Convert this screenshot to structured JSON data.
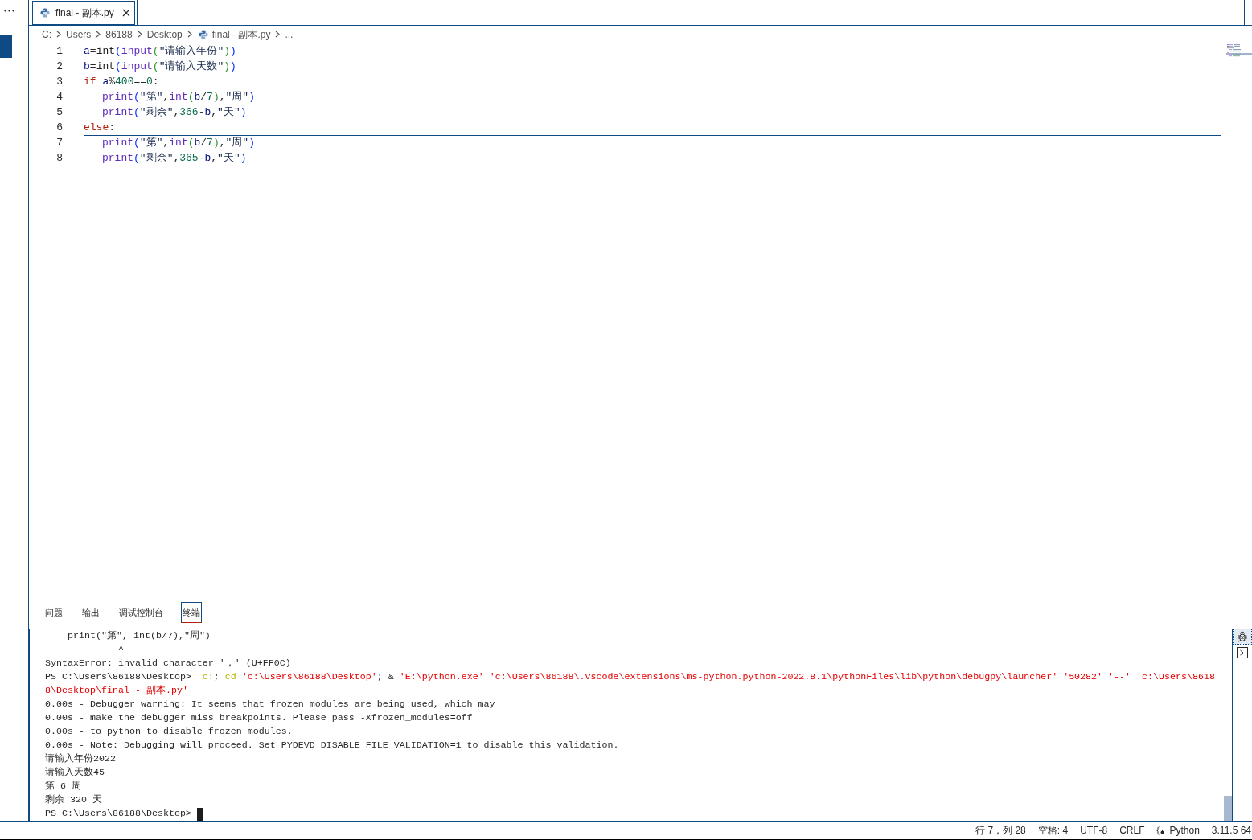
{
  "tabs": [
    {
      "label": "final - 副本.py",
      "selected": true
    }
  ],
  "breadcrumb": [
    {
      "text": "C:",
      "kind": "folder"
    },
    {
      "text": "Users",
      "kind": "folder"
    },
    {
      "text": "86188",
      "kind": "folder"
    },
    {
      "text": "Desktop",
      "kind": "folder"
    },
    {
      "text": "final - 副本.py",
      "kind": "file"
    },
    {
      "text": "...",
      "kind": "symbol"
    }
  ],
  "editor": {
    "lines": [
      {
        "number": "1",
        "active": false,
        "tokens": [
          {
            "text": "a",
            "kind": "variable"
          },
          {
            "text": "=",
            "kind": "operator"
          },
          {
            "text": "int",
            "kind": "type"
          },
          {
            "text": "(",
            "kind": "bracket1"
          },
          {
            "text": "input",
            "kind": "function"
          },
          {
            "text": "(",
            "kind": "bracket2"
          },
          {
            "text": "\"请输入年份\"",
            "kind": "string"
          },
          {
            "text": ")",
            "kind": "bracket2"
          },
          {
            "text": ")",
            "kind": "bracket1"
          }
        ]
      },
      {
        "number": "2",
        "active": false,
        "tokens": [
          {
            "text": "b",
            "kind": "variable"
          },
          {
            "text": "=",
            "kind": "operator"
          },
          {
            "text": "int",
            "kind": "type"
          },
          {
            "text": "(",
            "kind": "bracket1"
          },
          {
            "text": "input",
            "kind": "function"
          },
          {
            "text": "(",
            "kind": "bracket2"
          },
          {
            "text": "\"请输入天数\"",
            "kind": "string"
          },
          {
            "text": ")",
            "kind": "bracket2"
          },
          {
            "text": ")",
            "kind": "bracket1"
          }
        ]
      },
      {
        "number": "3",
        "active": false,
        "tokens": [
          {
            "text": "if ",
            "kind": "keyword"
          },
          {
            "text": "a",
            "kind": "variable"
          },
          {
            "text": "%",
            "kind": "operator"
          },
          {
            "text": "400",
            "kind": "number"
          },
          {
            "text": "==",
            "kind": "operator"
          },
          {
            "text": "0",
            "kind": "number"
          },
          {
            "text": ":",
            "kind": "operator"
          }
        ],
        "children": [
          {
            "number": "4",
            "active": false,
            "tokens": [
              {
                "text": "print",
                "kind": "function"
              },
              {
                "text": "(",
                "kind": "bracket1"
              },
              {
                "text": "\"第\"",
                "kind": "string"
              },
              {
                "text": ",",
                "kind": "operator"
              },
              {
                "text": "int",
                "kind": "function"
              },
              {
                "text": "(",
                "kind": "bracket2"
              },
              {
                "text": "b",
                "kind": "variable"
              },
              {
                "text": "/",
                "kind": "operator"
              },
              {
                "text": "7",
                "kind": "number"
              },
              {
                "text": ")",
                "kind": "bracket2"
              },
              {
                "text": ",",
                "kind": "operator"
              },
              {
                "text": "\"周\"",
                "kind": "string"
              },
              {
                "text": ")",
                "kind": "bracket1"
              }
            ]
          },
          {
            "number": "5",
            "active": false,
            "tokens": [
              {
                "text": "print",
                "kind": "function"
              },
              {
                "text": "(",
                "kind": "bracket1"
              },
              {
                "text": "\"剩余\"",
                "kind": "string"
              },
              {
                "text": ",",
                "kind": "operator"
              },
              {
                "text": "366",
                "kind": "number"
              },
              {
                "text": "-",
                "kind": "operator"
              },
              {
                "text": "b",
                "kind": "variable"
              },
              {
                "text": ",",
                "kind": "operator"
              },
              {
                "text": "\"天\"",
                "kind": "string"
              },
              {
                "text": ")",
                "kind": "bracket1"
              }
            ]
          }
        ]
      },
      {
        "number": "6",
        "active": false,
        "tokens": [
          {
            "text": "else",
            "kind": "keyword"
          },
          {
            "text": ":",
            "kind": "operator"
          }
        ],
        "children": [
          {
            "number": "7",
            "active": true,
            "tokens": [
              {
                "text": "print",
                "kind": "function"
              },
              {
                "text": "(",
                "kind": "bracket1"
              },
              {
                "text": "\"第\"",
                "kind": "string"
              },
              {
                "text": ",",
                "kind": "operator"
              },
              {
                "text": "int",
                "kind": "function"
              },
              {
                "text": "(",
                "kind": "bracket2"
              },
              {
                "text": "b",
                "kind": "variable"
              },
              {
                "text": "/",
                "kind": "operator"
              },
              {
                "text": "7",
                "kind": "number"
              },
              {
                "text": ")",
                "kind": "bracket2"
              },
              {
                "text": ",",
                "kind": "operator"
              },
              {
                "text": "\"周\"",
                "kind": "string"
              },
              {
                "text": ")",
                "kind": "bracket1"
              }
            ]
          },
          {
            "number": "8",
            "active": false,
            "tokens": [
              {
                "text": "print",
                "kind": "function"
              },
              {
                "text": "(",
                "kind": "bracket1"
              },
              {
                "text": "\"剩余\"",
                "kind": "string"
              },
              {
                "text": ",",
                "kind": "operator"
              },
              {
                "text": "365",
                "kind": "number"
              },
              {
                "text": "-",
                "kind": "operator"
              },
              {
                "text": "b",
                "kind": "variable"
              },
              {
                "text": ",",
                "kind": "operator"
              },
              {
                "text": "\"天\"",
                "kind": "string"
              },
              {
                "text": ")",
                "kind": "bracket1"
              }
            ]
          }
        ]
      }
    ]
  },
  "panel": {
    "tabs": [
      {
        "label": "问题",
        "selected": false
      },
      {
        "label": "输出",
        "selected": false
      },
      {
        "label": "调试控制台",
        "selected": false
      },
      {
        "label": "终端",
        "selected": true
      }
    ]
  },
  "terminal": {
    "rows": [
      {
        "segments": [
          {
            "text": "    print(\"第\", int(b/7),\"周\")",
            "kind": "plain"
          }
        ]
      },
      {
        "segments": [
          {
            "text": "             ^",
            "kind": "plain"
          }
        ]
      },
      {
        "segments": [
          {
            "text": "SyntaxError: invalid character '，' (U+FF0C)",
            "kind": "plain"
          }
        ]
      },
      {
        "segments": [
          {
            "text": "PS C:\\Users\\86188\\Desktop>  ",
            "kind": "plain"
          },
          {
            "text": "c:",
            "kind": "command"
          },
          {
            "text": "; ",
            "kind": "plain"
          },
          {
            "text": "cd ",
            "kind": "command"
          },
          {
            "text": "'c:\\Users\\86188\\Desktop'",
            "kind": "string"
          },
          {
            "text": "; & ",
            "kind": "plain"
          },
          {
            "text": "'E:\\python.exe' 'c:\\Users\\86188\\.vscode\\extensions\\ms-python.python-2022.8.1\\pythonFiles\\lib\\python\\debugpy\\launcher' '50282' '--' 'c:\\Users\\8618",
            "kind": "string"
          }
        ]
      },
      {
        "segments": [
          {
            "text": "8\\Desktop\\final - 副本.py'",
            "kind": "string"
          }
        ]
      },
      {
        "segments": [
          {
            "text": "0.00s - Debugger warning: It seems that frozen modules are being used, which may",
            "kind": "plain"
          }
        ]
      },
      {
        "segments": [
          {
            "text": "0.00s - make the debugger miss breakpoints. Please pass -Xfrozen_modules=off",
            "kind": "plain"
          }
        ]
      },
      {
        "segments": [
          {
            "text": "0.00s - to python to disable frozen modules.",
            "kind": "plain"
          }
        ]
      },
      {
        "segments": [
          {
            "text": "0.00s - Note: Debugging will proceed. Set PYDEVD_DISABLE_FILE_VALIDATION=1 to disable this validation.",
            "kind": "plain"
          }
        ]
      },
      {
        "segments": [
          {
            "text": "请输入年份2022",
            "kind": "plain"
          }
        ]
      },
      {
        "segments": [
          {
            "text": "请输入天数45",
            "kind": "plain"
          }
        ]
      },
      {
        "segments": [
          {
            "text": "第 6 周",
            "kind": "plain"
          }
        ]
      },
      {
        "segments": [
          {
            "text": "剩余 320 天",
            "kind": "plain"
          }
        ]
      },
      {
        "segments": [
          {
            "text": "PS C:\\Users\\86188\\Desktop>",
            "kind": "plain"
          }
        ]
      }
    ],
    "cursor": true
  },
  "status_bar": {
    "items": [
      {
        "text": "行 7，列 28",
        "kind": "plain"
      },
      {
        "text": "空格: 4",
        "kind": "plain"
      },
      {
        "text": "UTF-8",
        "kind": "plain"
      },
      {
        "text": "CRLF",
        "kind": "plain"
      },
      {
        "text": "Python",
        "kind": "language"
      },
      {
        "text": "3.11.5 64",
        "kind": "plain"
      }
    ]
  }
}
